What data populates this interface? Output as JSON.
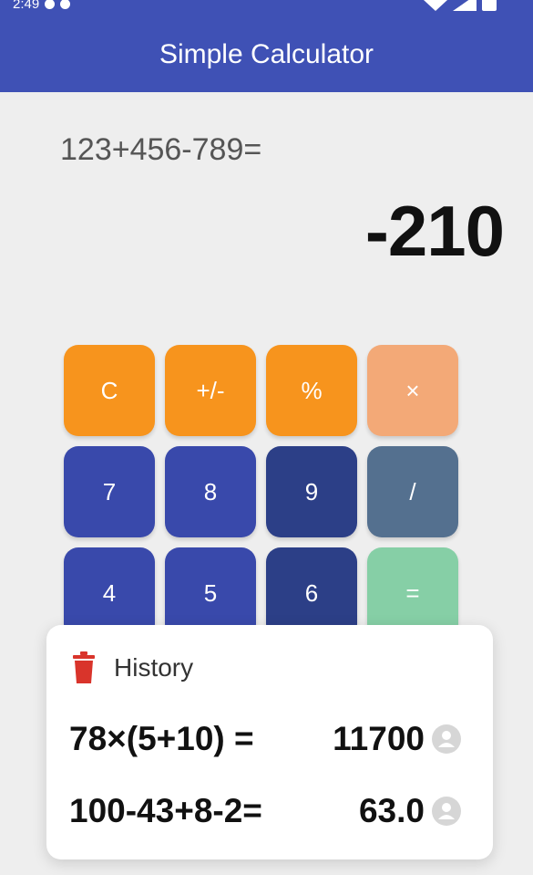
{
  "status_bar": {
    "time": "2:49"
  },
  "app_bar": {
    "title": "Simple Calculator",
    "color": "#3f51b5"
  },
  "display": {
    "expression": "123+456-789=",
    "result": "-210"
  },
  "keypad": {
    "keys": [
      {
        "label": "C",
        "color": "#f7941d"
      },
      {
        "label": "+/-",
        "color": "#f7941d"
      },
      {
        "label": "%",
        "color": "#f7941d"
      },
      {
        "label": "×",
        "color": "#f3a977"
      },
      {
        "label": "7",
        "color": "#3949ab"
      },
      {
        "label": "8",
        "color": "#3949ab"
      },
      {
        "label": "9",
        "color": "#2c3f87"
      },
      {
        "label": "/",
        "color": "#54708f"
      },
      {
        "label": "4",
        "color": "#3949ab"
      },
      {
        "label": "5",
        "color": "#3949ab"
      },
      {
        "label": "6",
        "color": "#2c3f87"
      },
      {
        "label": "=",
        "color": "#86cfa6"
      }
    ]
  },
  "history": {
    "title": "History",
    "icon": "trash-icon",
    "entries": [
      {
        "expression": "78×(5+10) =",
        "result": "11700"
      },
      {
        "expression": "100-43+8-2=",
        "result": "63.0"
      }
    ]
  }
}
